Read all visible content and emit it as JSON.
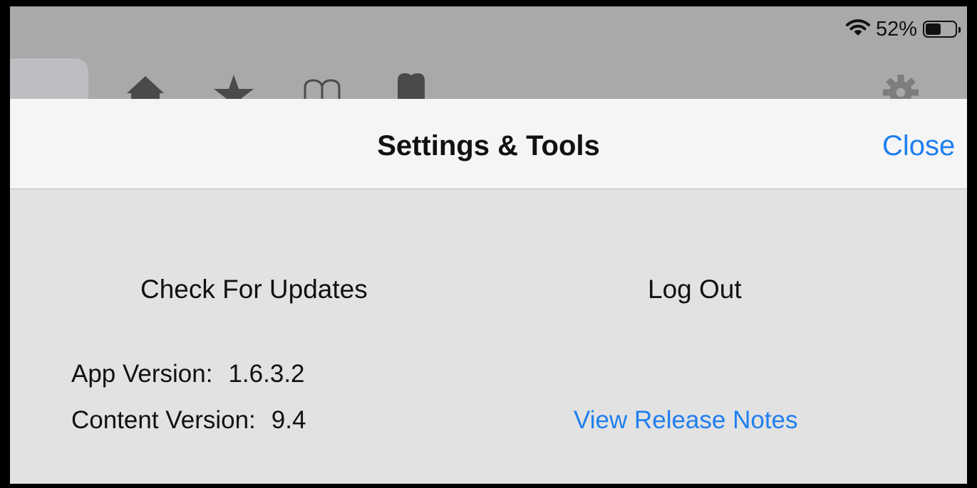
{
  "status_bar": {
    "battery_percent": "52%",
    "battery_level": 0.52,
    "wifi_icon": "wifi-icon",
    "battery_icon": "battery-icon"
  },
  "toolbar": {
    "icons": [
      "home-icon",
      "star-icon",
      "book-icon",
      "tooth-icon",
      "gear-icon"
    ]
  },
  "sheet": {
    "title": "Settings & Tools",
    "close_label": "Close",
    "check_updates_label": "Check For Updates",
    "logout_label": "Log Out",
    "app_version_label": "App Version:",
    "app_version_value": "1.6.3.2",
    "content_version_label": "Content Version:",
    "content_version_value": "9.4",
    "release_notes_label": "View Release Notes"
  },
  "colors": {
    "accent": "#1f7ff0",
    "sheet_background": "#e2e2e2",
    "header_background": "#f5f5f5",
    "status_bar_background": "#a9a9a9"
  }
}
